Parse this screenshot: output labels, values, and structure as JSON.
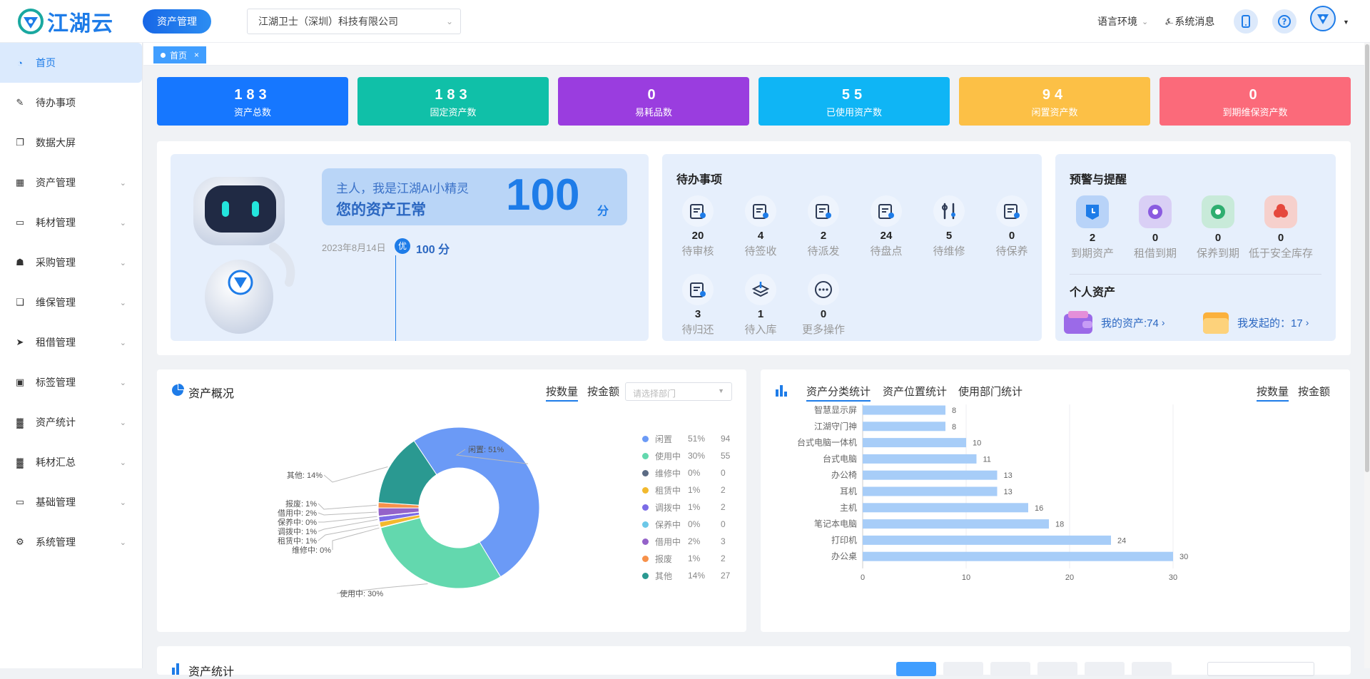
{
  "header": {
    "logo_text": "江湖云",
    "module_label": "资产管理",
    "company": "江湖卫士（深圳）科技有限公司",
    "language": "语言环境",
    "system_message": "系统消息"
  },
  "sidebar": {
    "items": [
      {
        "label": "首页",
        "icon": "dashboard-icon"
      },
      {
        "label": "待办事项",
        "icon": "edit-icon"
      },
      {
        "label": "数据大屏",
        "icon": "screen-icon"
      },
      {
        "label": "资产管理",
        "icon": "grid-icon"
      },
      {
        "label": "耗材管理",
        "icon": "book-icon"
      },
      {
        "label": "采购管理",
        "icon": "cart-icon"
      },
      {
        "label": "维保管理",
        "icon": "copy-icon"
      },
      {
        "label": "租借管理",
        "icon": "send-icon"
      },
      {
        "label": "标签管理",
        "icon": "tag-icon"
      },
      {
        "label": "资产统计",
        "icon": "bar-chart-icon"
      },
      {
        "label": "耗材汇总",
        "icon": "bar-chart-icon"
      },
      {
        "label": "基础管理",
        "icon": "book-icon"
      },
      {
        "label": "系统管理",
        "icon": "gear-icon"
      }
    ]
  },
  "tabs": {
    "home": "首页",
    "close": "×"
  },
  "stats": [
    {
      "value": "183",
      "label": "资产总数",
      "color": "#1677ff"
    },
    {
      "value": "183",
      "label": "固定资产数",
      "color": "#10c0a8"
    },
    {
      "value": "0",
      "label": "易耗品数",
      "color": "#9a3ddf"
    },
    {
      "value": "55",
      "label": "已使用资产数",
      "color": "#0fb5f5"
    },
    {
      "value": "94",
      "label": "闲置资产数",
      "color": "#fcc046"
    },
    {
      "value": "0",
      "label": "到期维保资产数",
      "color": "#fb6a7a"
    }
  ],
  "ai": {
    "greeting": "主人，我是江湖AI小精灵",
    "status": "您的资产正常",
    "score": "100",
    "score_unit": "分",
    "date": "2023年8月14日",
    "badge": "优",
    "score_text": "100 分"
  },
  "todo": {
    "title": "待办事项",
    "items": [
      {
        "count": "20",
        "label": "待审核"
      },
      {
        "count": "4",
        "label": "待签收"
      },
      {
        "count": "2",
        "label": "待派发"
      },
      {
        "count": "24",
        "label": "待盘点"
      },
      {
        "count": "5",
        "label": "待维修"
      },
      {
        "count": "0",
        "label": "待保养"
      },
      {
        "count": "3",
        "label": "待归还"
      },
      {
        "count": "1",
        "label": "待入库"
      },
      {
        "count": "0",
        "label": "更多操作"
      }
    ]
  },
  "alerts": {
    "title": "预警与提醒",
    "items": [
      {
        "count": "2",
        "label": "到期资产",
        "color": "#b8d3f8"
      },
      {
        "count": "0",
        "label": "租借到期",
        "color": "#d9cff5"
      },
      {
        "count": "0",
        "label": "保养到期",
        "color": "#c8ead9"
      },
      {
        "count": "0",
        "label": "低于安全库存",
        "color": "#f6d0cc"
      }
    ],
    "personal_title": "个人资产",
    "my_assets": "我的资产:74",
    "my_started": "我发起的：17"
  },
  "overview": {
    "title": "资产概况",
    "by_count": "按数量",
    "by_amount": "按金额",
    "dept_placeholder": "请选择部门"
  },
  "classify": {
    "tab1": "资产分类统计",
    "tab2": "资产位置统计",
    "tab3": "使用部门统计",
    "by_count": "按数量",
    "by_amount": "按金额"
  },
  "bottom": {
    "title": "资产统计"
  },
  "chart_data": [
    {
      "type": "pie",
      "title": "资产概况",
      "slices": [
        {
          "name": "闲置",
          "pct": "51%",
          "value": 94,
          "color": "#6b9af6",
          "label": "闲置: 51%"
        },
        {
          "name": "使用中",
          "pct": "30%",
          "value": 55,
          "color": "#63d8ae",
          "label": "使用中: 30%"
        },
        {
          "name": "维修中",
          "pct": "0%",
          "value": 0,
          "color": "#5b6b84",
          "label": "维修中: 0%"
        },
        {
          "name": "租赁中",
          "pct": "1%",
          "value": 2,
          "color": "#f2b92e",
          "label": "租赁中: 1%"
        },
        {
          "name": "调拨中",
          "pct": "1%",
          "value": 2,
          "color": "#7b6ce6",
          "label": "调拨中: 1%"
        },
        {
          "name": "保养中",
          "pct": "0%",
          "value": 0,
          "color": "#6cc8e8",
          "label": "保养中: 0%"
        },
        {
          "name": "借用中",
          "pct": "2%",
          "value": 3,
          "color": "#9462c9",
          "label": "借用中: 2%"
        },
        {
          "name": "报废",
          "pct": "1%",
          "value": 2,
          "color": "#f7914a",
          "label": "报废: 1%"
        },
        {
          "name": "其他",
          "pct": "14%",
          "value": 27,
          "color": "#2a9991",
          "label": "其他: 14%"
        }
      ]
    },
    {
      "type": "bar",
      "orientation": "horizontal",
      "categories": [
        "智慧显示屏",
        "江湖守门神",
        "台式电脑一体机",
        "台式电脑",
        "办公椅",
        "耳机",
        "主机",
        "笔记本电脑",
        "打印机",
        "办公桌"
      ],
      "values": [
        8,
        8,
        10,
        11,
        13,
        13,
        16,
        18,
        24,
        30
      ],
      "xlim": [
        0,
        30
      ],
      "xticks": [
        "0",
        "10",
        "20",
        "30"
      ],
      "color": "#a7cdf8"
    }
  ]
}
